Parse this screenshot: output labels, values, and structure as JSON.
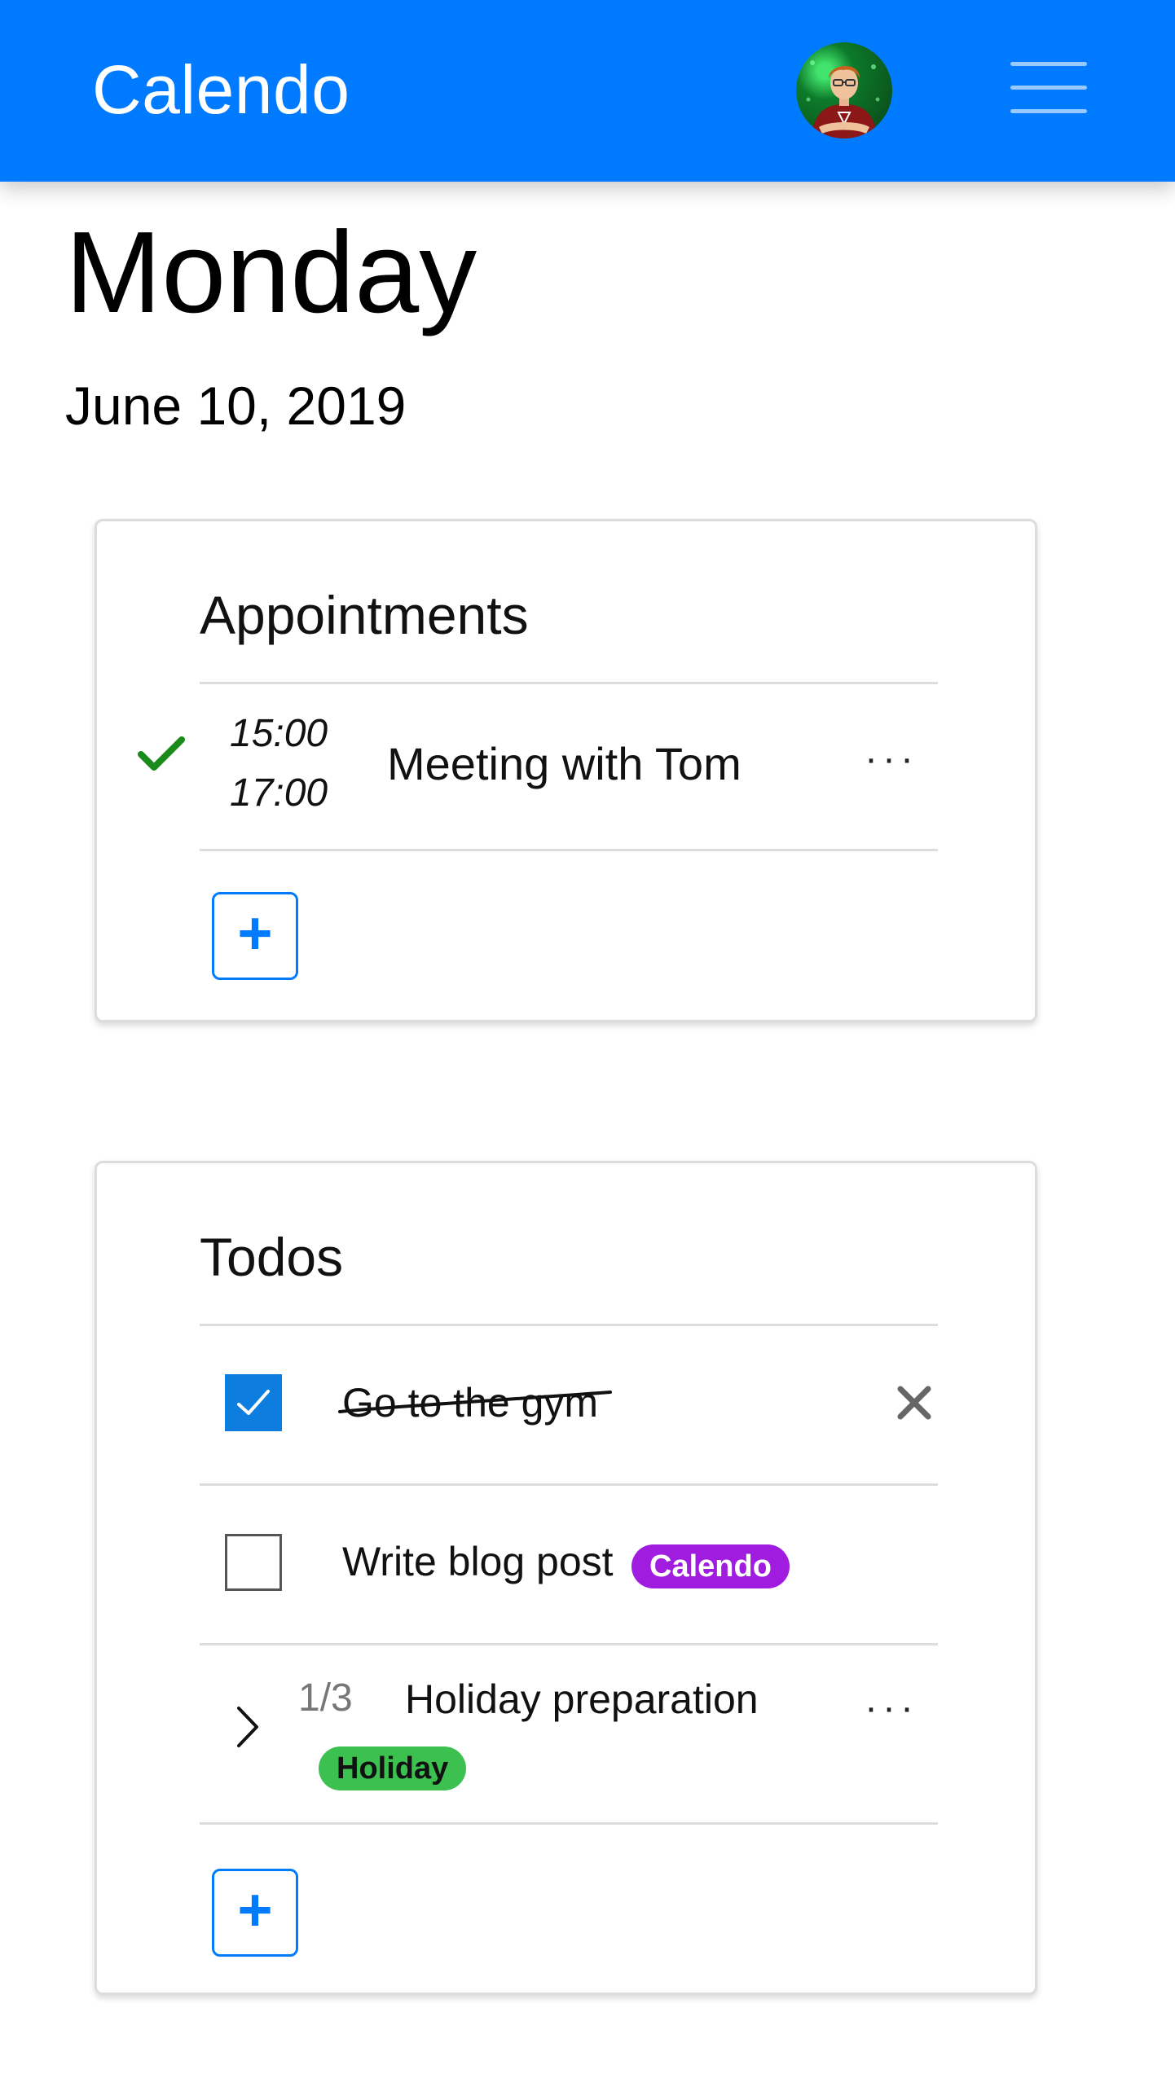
{
  "header": {
    "brand": "Calendo",
    "avatar_alt": "User avatar",
    "menu_icon": "hamburger-menu-icon",
    "color": "#007bff"
  },
  "page": {
    "day": "Monday",
    "date": "June 10, 2019"
  },
  "appointments": {
    "title": "Appointments",
    "items": [
      {
        "start": "15:00",
        "end": "17:00",
        "title": "Meeting with Tom",
        "status_icon": "check-icon",
        "more_label": "···"
      }
    ],
    "add_label": "+"
  },
  "todos": {
    "title": "Todos",
    "items": [
      {
        "text": "Go to the gym",
        "checked": true,
        "action_icon": "close-icon"
      },
      {
        "text": "Write blog post",
        "checked": false,
        "badge": {
          "label": "Calendo",
          "color": "#a01de0"
        }
      },
      {
        "text": "Holiday preparation",
        "progress": "1/3",
        "badge": {
          "label": "Holiday",
          "color": "#3cc04f"
        },
        "more_label": "···",
        "expand_icon": "chevron-right-icon"
      }
    ],
    "add_label": "+"
  },
  "colors": {
    "accent": "#007bff",
    "check_green": "#1a8a1a",
    "checkbox_blue": "#0d7de0"
  }
}
